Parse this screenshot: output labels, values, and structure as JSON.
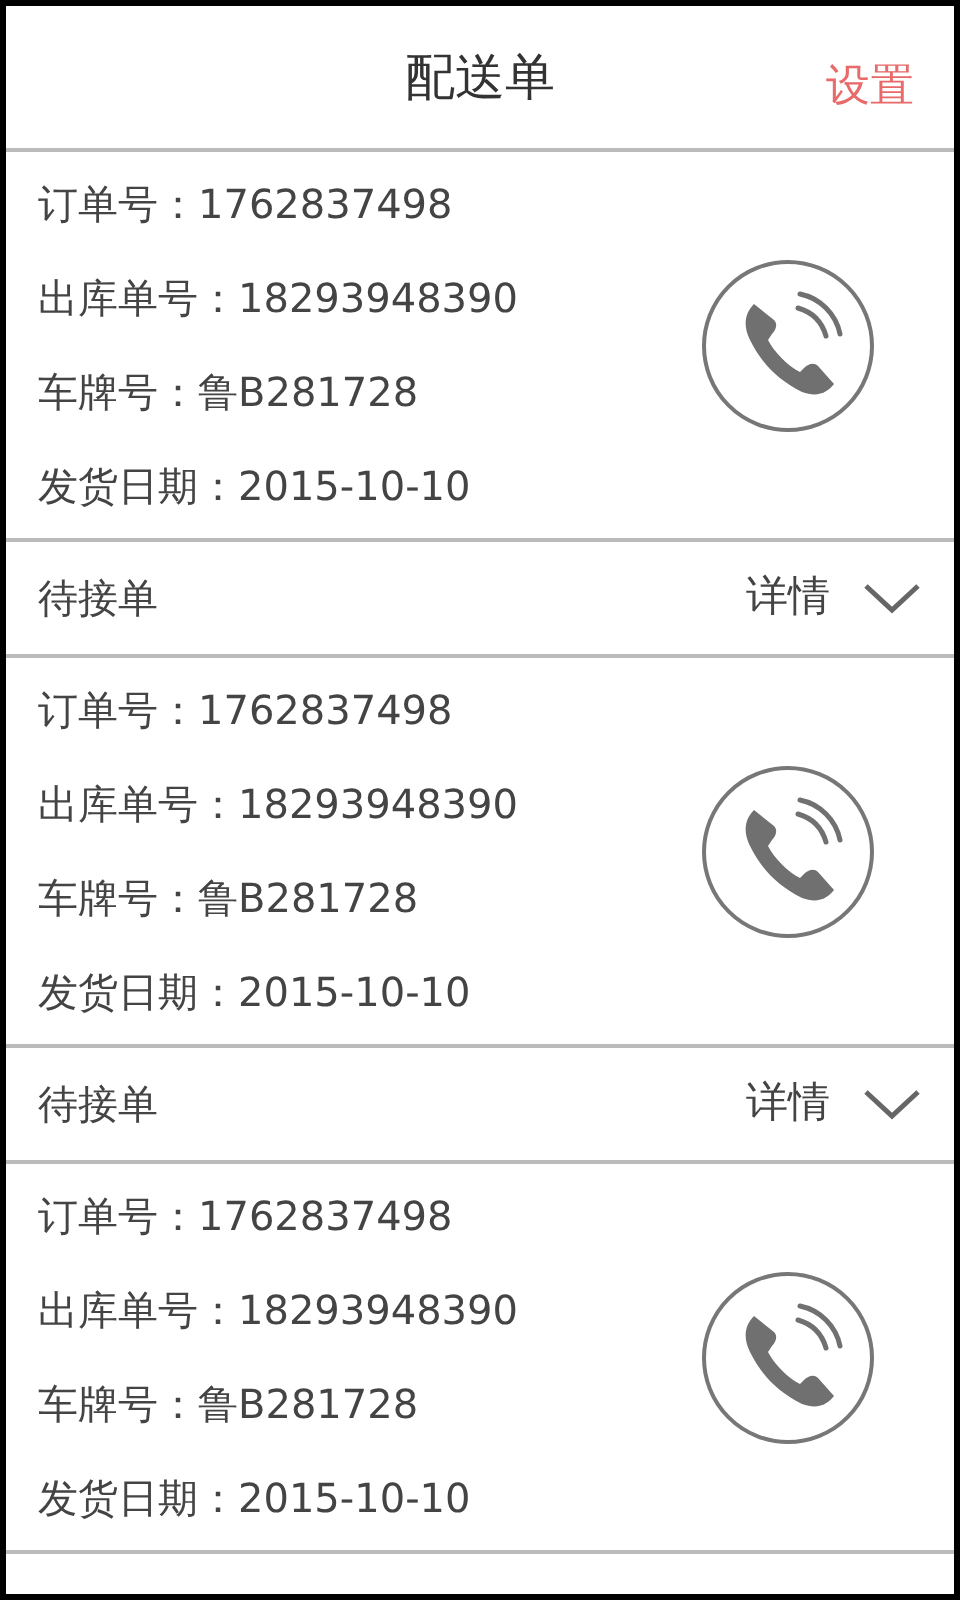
{
  "header": {
    "title": "配送单",
    "action": "设置"
  },
  "orders": [
    {
      "fields": [
        {
          "label": "订单号：",
          "value": "1762837498"
        },
        {
          "label": "出库单号：",
          "value": "18293948390"
        },
        {
          "label": "车牌号：",
          "value": "鲁B281728"
        },
        {
          "label": "发货日期：",
          "value": "2015-10-10"
        }
      ],
      "status": "待接单",
      "details": "详情"
    },
    {
      "fields": [
        {
          "label": "订单号：",
          "value": "1762837498"
        },
        {
          "label": "出库单号：",
          "value": "18293948390"
        },
        {
          "label": "车牌号：",
          "value": "鲁B281728"
        },
        {
          "label": "发货日期：",
          "value": "2015-10-10"
        }
      ],
      "status": "待接单",
      "details": "详情"
    },
    {
      "fields": [
        {
          "label": "订单号：",
          "value": "1762837498"
        },
        {
          "label": "出库单号：",
          "value": "18293948390"
        },
        {
          "label": "车牌号：",
          "value": "鲁B281728"
        },
        {
          "label": "发货日期：",
          "value": "2015-10-10"
        }
      ]
    }
  ]
}
